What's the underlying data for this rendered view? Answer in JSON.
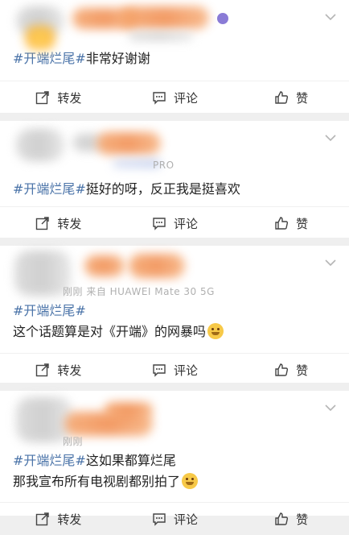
{
  "posts": [
    {
      "hashtag": "#开端烂尾#",
      "text": "非常好谢谢",
      "device": "",
      "actions": {
        "share": "转发",
        "comment": "评论",
        "like": "赞"
      }
    },
    {
      "hashtag": "#开端烂尾#",
      "text": "挺好的呀，反正我是挺喜欢",
      "device": "PRO",
      "actions": {
        "share": "转发",
        "comment": "评论",
        "like": "赞"
      }
    },
    {
      "hashtag": "#开端烂尾#",
      "text": "这个话题算是对《开端》的网暴吗",
      "device": "刚刚  来自 HUAWEI Mate 30 5G",
      "actions": {
        "share": "转发",
        "comment": "评论",
        "like": "赞"
      }
    },
    {
      "hashtag": "#开端烂尾#",
      "text": "这如果都算烂尾",
      "text2": "那我宣布所有电视剧都别拍了",
      "device": "刚刚",
      "actions": {
        "share": "转发",
        "comment": "评论",
        "like": "赞"
      }
    }
  ],
  "icons": {
    "share": "share-icon",
    "comment": "comment-icon",
    "like": "thumbs-up-icon",
    "more": "chevron-down-icon"
  },
  "colors": {
    "hashtag": "#4a73a8",
    "divider": "#efefef"
  }
}
